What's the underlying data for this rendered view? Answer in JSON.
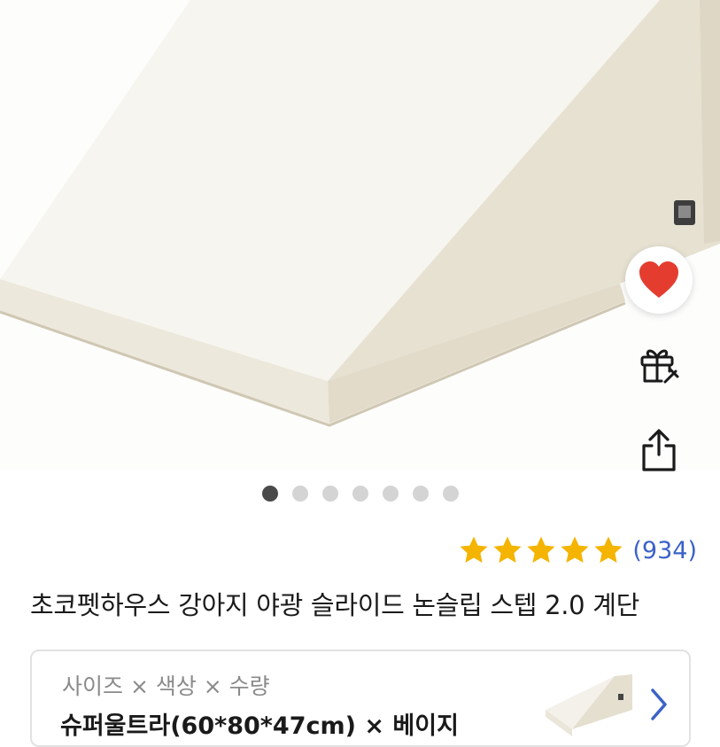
{
  "product": {
    "title": "초코펫하우스 강아지 야광 슬라이드 논슬립 스텝 2.0 계단",
    "rating": 5,
    "review_count": "(934)",
    "image_count": 7,
    "active_image_index": 0
  },
  "option": {
    "label": "사이즈 × 색상 × 수량",
    "value": "슈퍼울트라(60*80*47cm) × 베이지"
  },
  "icons": {
    "favorite": "heart-icon",
    "gift": "gift-icon",
    "share": "share-icon",
    "chevron": "chevron-right-icon",
    "star": "star-icon"
  },
  "colors": {
    "heart": "#e43d30",
    "star": "#f4b400",
    "review_link": "#3b62c8",
    "dot_active": "#4a4a4a",
    "dot_inactive": "#d4d4d4"
  }
}
